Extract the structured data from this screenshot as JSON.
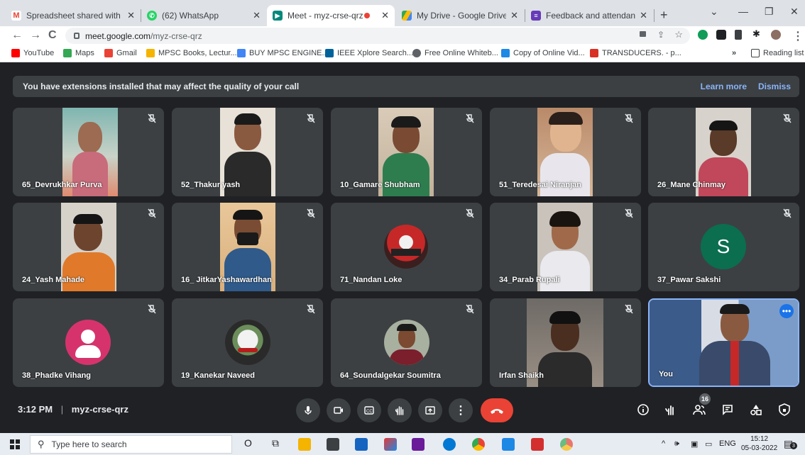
{
  "browser": {
    "tabs": [
      {
        "title": "Spreadsheet shared with you",
        "color": "#ea4335"
      },
      {
        "title": "(62) WhatsApp",
        "color": "#25d366"
      },
      {
        "title": "Meet - myz-crse-qrz",
        "color": "#00897b"
      },
      {
        "title": "My Drive - Google Drive",
        "color": "#fbbc04"
      },
      {
        "title": "Feedback and attendance of",
        "color": "#673ab7"
      }
    ],
    "new_tab": "+",
    "url_host": "meet.google.com",
    "url_path": "/myz-crse-qrz",
    "bookmarks": [
      {
        "label": "YouTube",
        "color": "#ff0000"
      },
      {
        "label": "Maps",
        "color": "#34a853"
      },
      {
        "label": "Gmail",
        "color": "#ea4335"
      },
      {
        "label": "MPSC Books, Lectur...",
        "color": "#f4b400"
      },
      {
        "label": "BUY MPSC ENGINE...",
        "color": "#4285f4"
      },
      {
        "label": "IEEE Xplore Search...",
        "color": "#00629b"
      },
      {
        "label": "Free Online Whiteb...",
        "color": "#5f6368"
      },
      {
        "label": "Copy of Online Vid...",
        "color": "#1e88e5"
      },
      {
        "label": "TRANSDUCERS. - p...",
        "color": "#d93025"
      }
    ],
    "more_bookmarks": "»",
    "reading_list": "Reading list"
  },
  "meet": {
    "banner_text": "You have extensions installed that may affect the quality of your call",
    "learn_more": "Learn more",
    "dismiss": "Dismiss",
    "participants": [
      {
        "name": "65_Devrukhkar Purva"
      },
      {
        "name": "52_Thakur yash"
      },
      {
        "name": "10_Gamare Shubham"
      },
      {
        "name": "51_Teredesai Niranjan"
      },
      {
        "name": "26_Mane Chinmay"
      },
      {
        "name": "24_Yash Mahade"
      },
      {
        "name": "16_ JitkarYashawardhan"
      },
      {
        "name": "71_Nandan Loke"
      },
      {
        "name": "34_Parab Rupali"
      },
      {
        "name": "37_Pawar Sakshi",
        "initial": "S"
      },
      {
        "name": "38_Phadke Vihang"
      },
      {
        "name": "19_Kanekar Naveed"
      },
      {
        "name": "64_Soundalgekar Soumitra"
      },
      {
        "name": "Irfan Shaikh"
      },
      {
        "name": "You"
      }
    ],
    "time": "3:12 PM",
    "separator": "|",
    "meeting_code": "myz-crse-qrz",
    "people_count": "16"
  },
  "taskbar": {
    "search_placeholder": "Type here to search",
    "lang": "ENG",
    "clock_time": "15:12",
    "clock_date": "05-03-2022",
    "notification_count": "3"
  }
}
